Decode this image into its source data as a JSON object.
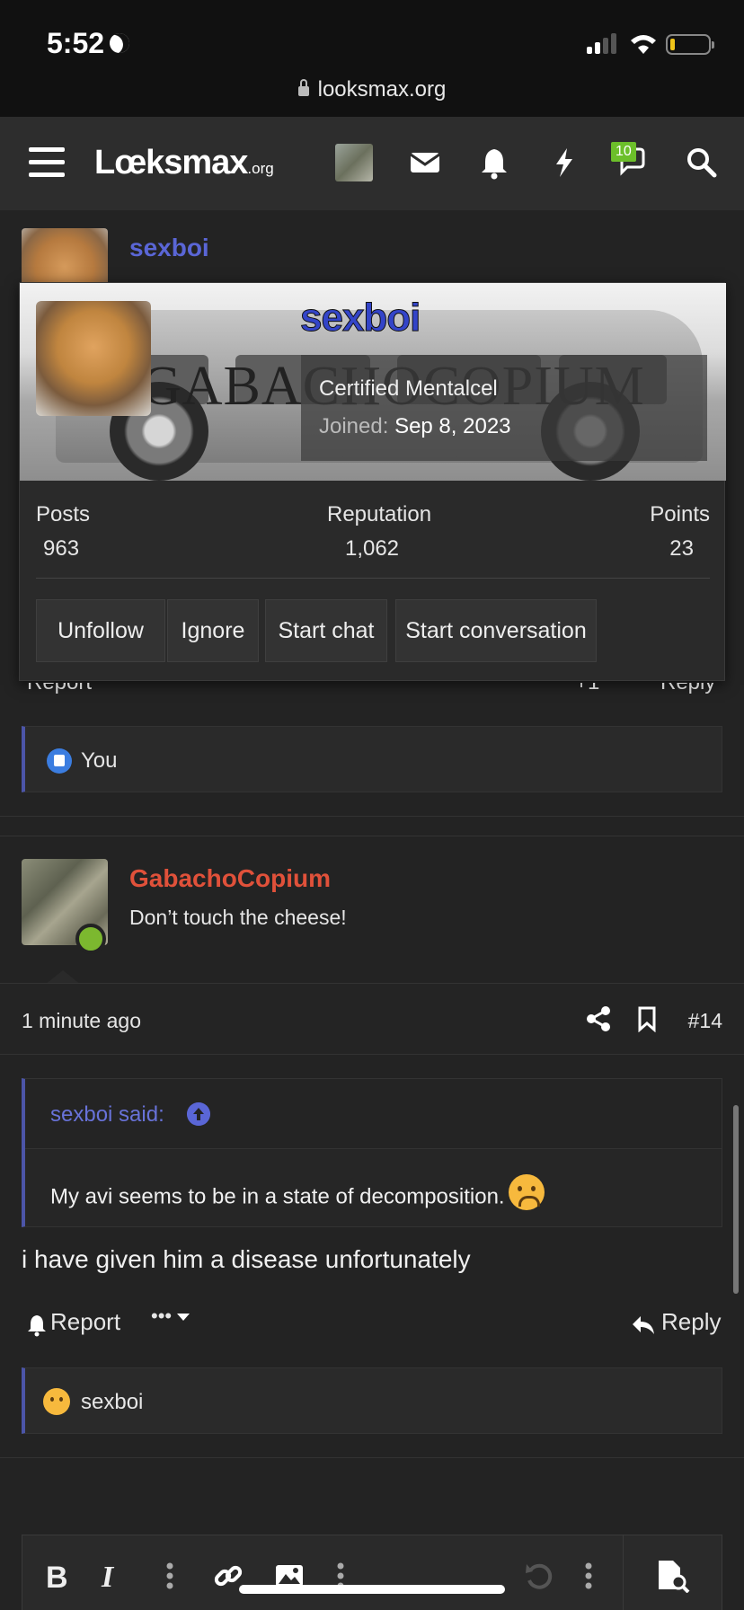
{
  "status_bar": {
    "time": "5:52",
    "url": "looksmax.org"
  },
  "nav": {
    "logo": "Lœksmax",
    "logo_suffix": ".org",
    "chat_badge": "10"
  },
  "post_above": {
    "username": "sexboi"
  },
  "member_popup": {
    "username": "sexboi",
    "banner_text": "GABACHOCOPIUM",
    "user_title": "Certified Mentalcel",
    "joined_label": "Joined:",
    "joined_value": "Sep 8, 2023",
    "stats": [
      {
        "label": "Posts",
        "value": "963"
      },
      {
        "label": "Reputation",
        "value": "1,062"
      },
      {
        "label": "Points",
        "value": "23"
      }
    ],
    "buttons": [
      "Unfollow",
      "Ignore",
      "Start chat",
      "Start conversation"
    ]
  },
  "post_above_actions": {
    "report": "Report",
    "plus_one": "+1",
    "reply": "Reply"
  },
  "reactions_1": {
    "text": "You"
  },
  "post": {
    "username": "GabachoCopium",
    "user_title": "Don’t touch the cheese!",
    "time": "1 minute ago",
    "number": "#14",
    "quote_attribution": "sexboi said:",
    "quote_text": "My avi seems to be in a state of decomposition.",
    "body": "i have given him a disease unfortunately",
    "report_label": "Report",
    "more_label": "•••",
    "reply_label": "Reply"
  },
  "reactions_2": {
    "text": "sexboi"
  },
  "editor": {
    "bold": "B",
    "italic": "I"
  },
  "colors": {
    "accent": "#5a66d6",
    "username_red": "#e0513a",
    "online": "#7cb82f",
    "badge": "#6cbf2a"
  }
}
